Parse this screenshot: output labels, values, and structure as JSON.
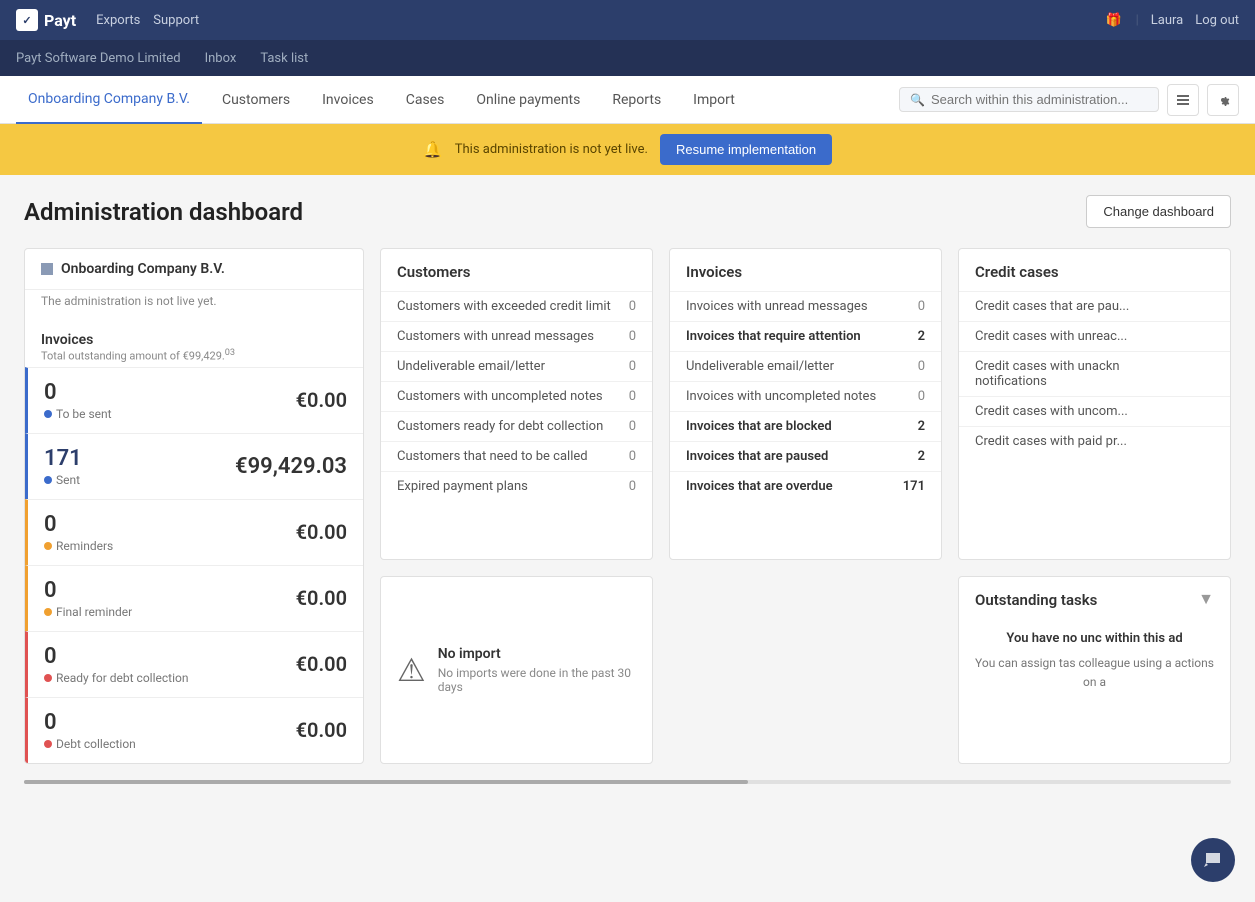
{
  "brand": {
    "name": "Payt",
    "icon_text": "✓P"
  },
  "top_nav": {
    "exports": "Exports",
    "support": "Support",
    "user": "Laura",
    "logout": "Log out"
  },
  "sub_nav": {
    "company": "Payt Software Demo Limited",
    "inbox": "Inbox",
    "task_list": "Task list"
  },
  "main_nav": {
    "links": [
      {
        "label": "Onboarding Company B.V.",
        "active": true
      },
      {
        "label": "Customers",
        "active": false
      },
      {
        "label": "Invoices",
        "active": false
      },
      {
        "label": "Cases",
        "active": false
      },
      {
        "label": "Online payments",
        "active": false
      },
      {
        "label": "Reports",
        "active": false
      },
      {
        "label": "Import",
        "active": false
      }
    ],
    "search_placeholder": "Search within this administration..."
  },
  "banner": {
    "text": "This administration is not yet live.",
    "button": "Resume implementation"
  },
  "dashboard": {
    "title": "Administration dashboard",
    "change_btn": "Change dashboard"
  },
  "company_card": {
    "name": "Onboarding Company B.V.",
    "subtitle": "The administration is not live yet."
  },
  "invoices_summary": {
    "title": "Invoices",
    "subtitle": "Total outstanding amount of €99,429.",
    "subtitle_sup": "03",
    "rows": [
      {
        "count": "0",
        "label": "To be sent",
        "dot": "blue",
        "amount": "€0.00",
        "accent": "blue"
      },
      {
        "count": "171",
        "label": "Sent",
        "dot": "blue",
        "amount": "€99,429.03",
        "accent": "blue"
      },
      {
        "count": "0",
        "label": "Reminders",
        "dot": "orange",
        "amount": "€0.00",
        "accent": "orange"
      },
      {
        "count": "0",
        "label": "Final reminder",
        "dot": "orange",
        "amount": "€0.00",
        "accent": "orange"
      },
      {
        "count": "0",
        "label": "Ready for debt collection",
        "dot": "red",
        "amount": "€0.00",
        "accent": "red"
      },
      {
        "count": "0",
        "label": "Debt collection",
        "dot": "red",
        "amount": "€0.00",
        "accent": "red"
      }
    ]
  },
  "customers_card": {
    "title": "Customers",
    "rows": [
      {
        "label": "Customers with exceeded credit limit",
        "value": "0",
        "bold": false
      },
      {
        "label": "Customers with unread messages",
        "value": "0",
        "bold": false
      },
      {
        "label": "Undeliverable email/letter",
        "value": "0",
        "bold": false
      },
      {
        "label": "Customers with uncompleted notes",
        "value": "0",
        "bold": false
      },
      {
        "label": "Customers ready for debt collection",
        "value": "0",
        "bold": false
      },
      {
        "label": "Customers that need to be called",
        "value": "0",
        "bold": false
      },
      {
        "label": "Expired payment plans",
        "value": "0",
        "bold": false
      }
    ]
  },
  "invoices_card": {
    "title": "Invoices",
    "rows": [
      {
        "label": "Invoices with unread messages",
        "value": "0",
        "bold": false
      },
      {
        "label": "Invoices that require attention",
        "value": "2",
        "bold": true
      },
      {
        "label": "Undeliverable email/letter",
        "value": "0",
        "bold": false
      },
      {
        "label": "Invoices with uncompleted notes",
        "value": "0",
        "bold": false
      },
      {
        "label": "Invoices that are blocked",
        "value": "2",
        "bold": true
      },
      {
        "label": "Invoices that are paused",
        "value": "2",
        "bold": true
      },
      {
        "label": "Invoices that are overdue",
        "value": "171",
        "bold": true
      }
    ]
  },
  "import_card": {
    "title": "No import",
    "subtitle": "No imports were done in the past 30 days"
  },
  "credit_cases_card": {
    "title": "Credit cases",
    "rows": [
      {
        "label": "Credit cases that are pau",
        "value": "",
        "bold": false
      },
      {
        "label": "Credit cases with unreac",
        "value": "",
        "bold": false
      },
      {
        "label": "Credit cases with unackr notifications",
        "value": "",
        "bold": false
      },
      {
        "label": "Credit cases with uncom",
        "value": "",
        "bold": false
      },
      {
        "label": "Credit cases with paid pr",
        "value": "",
        "bold": false
      }
    ]
  },
  "outstanding_tasks": {
    "title": "Outstanding tasks",
    "bold_text": "You have no unc within this ad",
    "text": "You can assign tas colleague using a actions on a"
  }
}
